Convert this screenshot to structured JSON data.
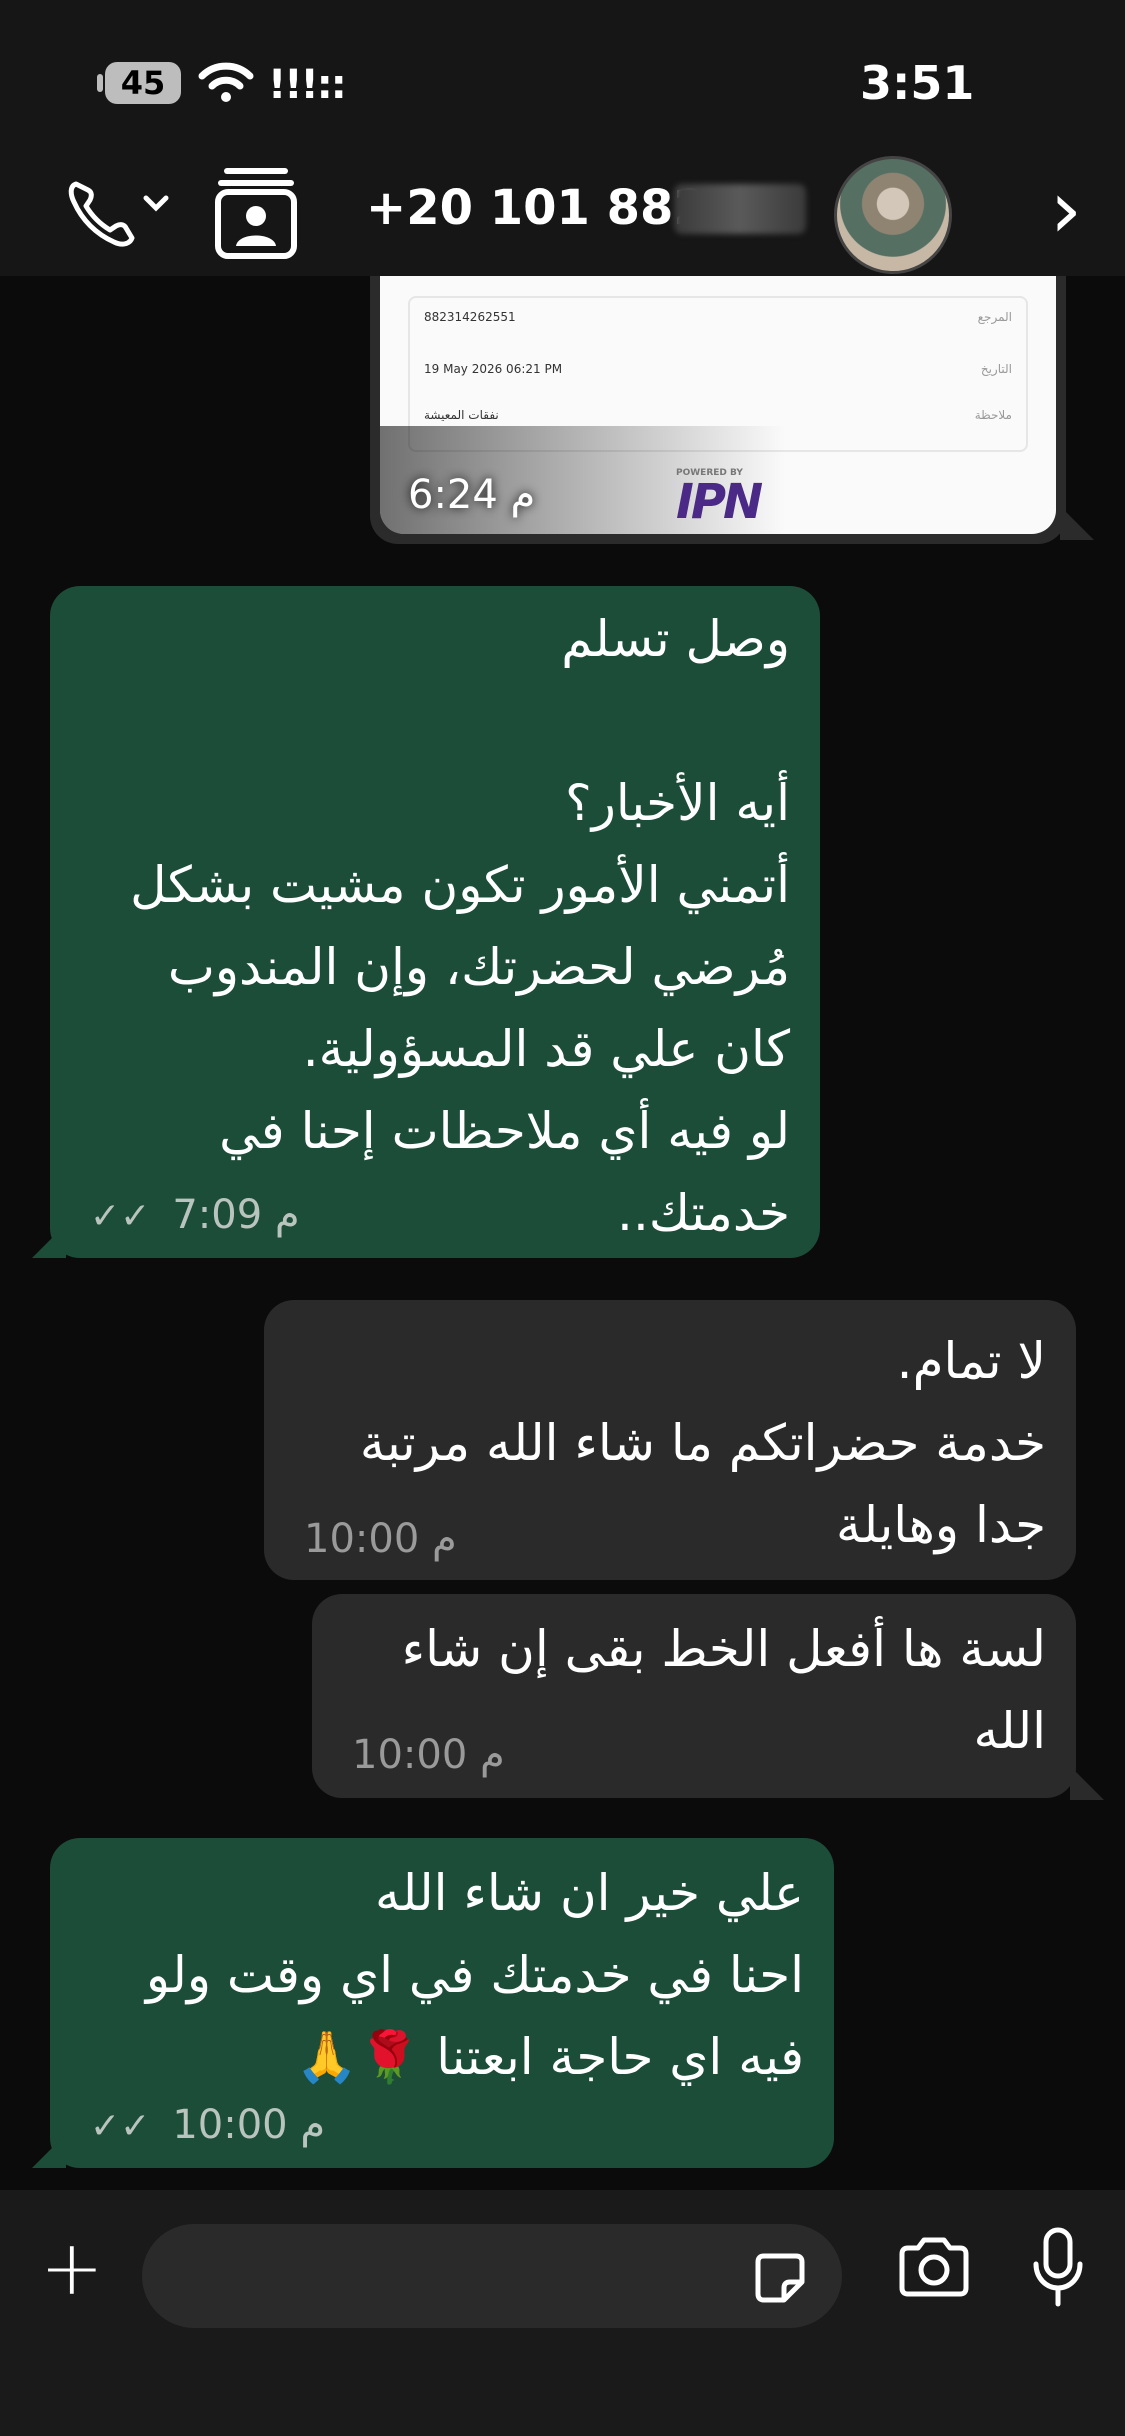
{
  "status_bar": {
    "battery": "45",
    "signal": "!!!::",
    "time": "3:51"
  },
  "header": {
    "contact_number": "+20 101 882"
  },
  "image_message": {
    "rows": [
      {
        "key": "المرجع",
        "value": "882314262551"
      },
      {
        "key": "التاريخ",
        "value": "19 May 2026 06:21 PM"
      },
      {
        "key": "ملاحظة",
        "value": "نفقات المعيشة"
      }
    ],
    "powered_by": "POWERED BY",
    "logo_text": "IPN",
    "time": "6:24 م"
  },
  "messages": [
    {
      "text": "وصل تسلم\n\nأيه الأخبار؟\nأتمني الأمور تكون مشيت بشكل\nمُرضي لحضرتك، وإن المندوب\nكان علي قد المسؤولية.\nلو فيه أي ملاحظات إحنا في\nخدمتك..",
      "time": "7:09 م",
      "ticks": "✓✓"
    },
    {
      "text": "لا تمام.\nخدمة حضراتكم ما شاء الله مرتبة\nجدا وهايلة",
      "time": "10:00 م"
    },
    {
      "text": "لسة ها أفعل الخط بقى إن شاء\nالله",
      "time": "10:00 م"
    },
    {
      "text": "علي خير ان شاء الله\nاحنا في خدمتك في اي وقت ولو\nفيه اي حاجة ابعتنا 🌹🙏",
      "time": "10:00 م",
      "ticks": "✓✓"
    }
  ],
  "colors": {
    "sent_bubble": "#1c4d39",
    "received_bubble": "#2a2a2a",
    "background": "#0b0b0b"
  }
}
